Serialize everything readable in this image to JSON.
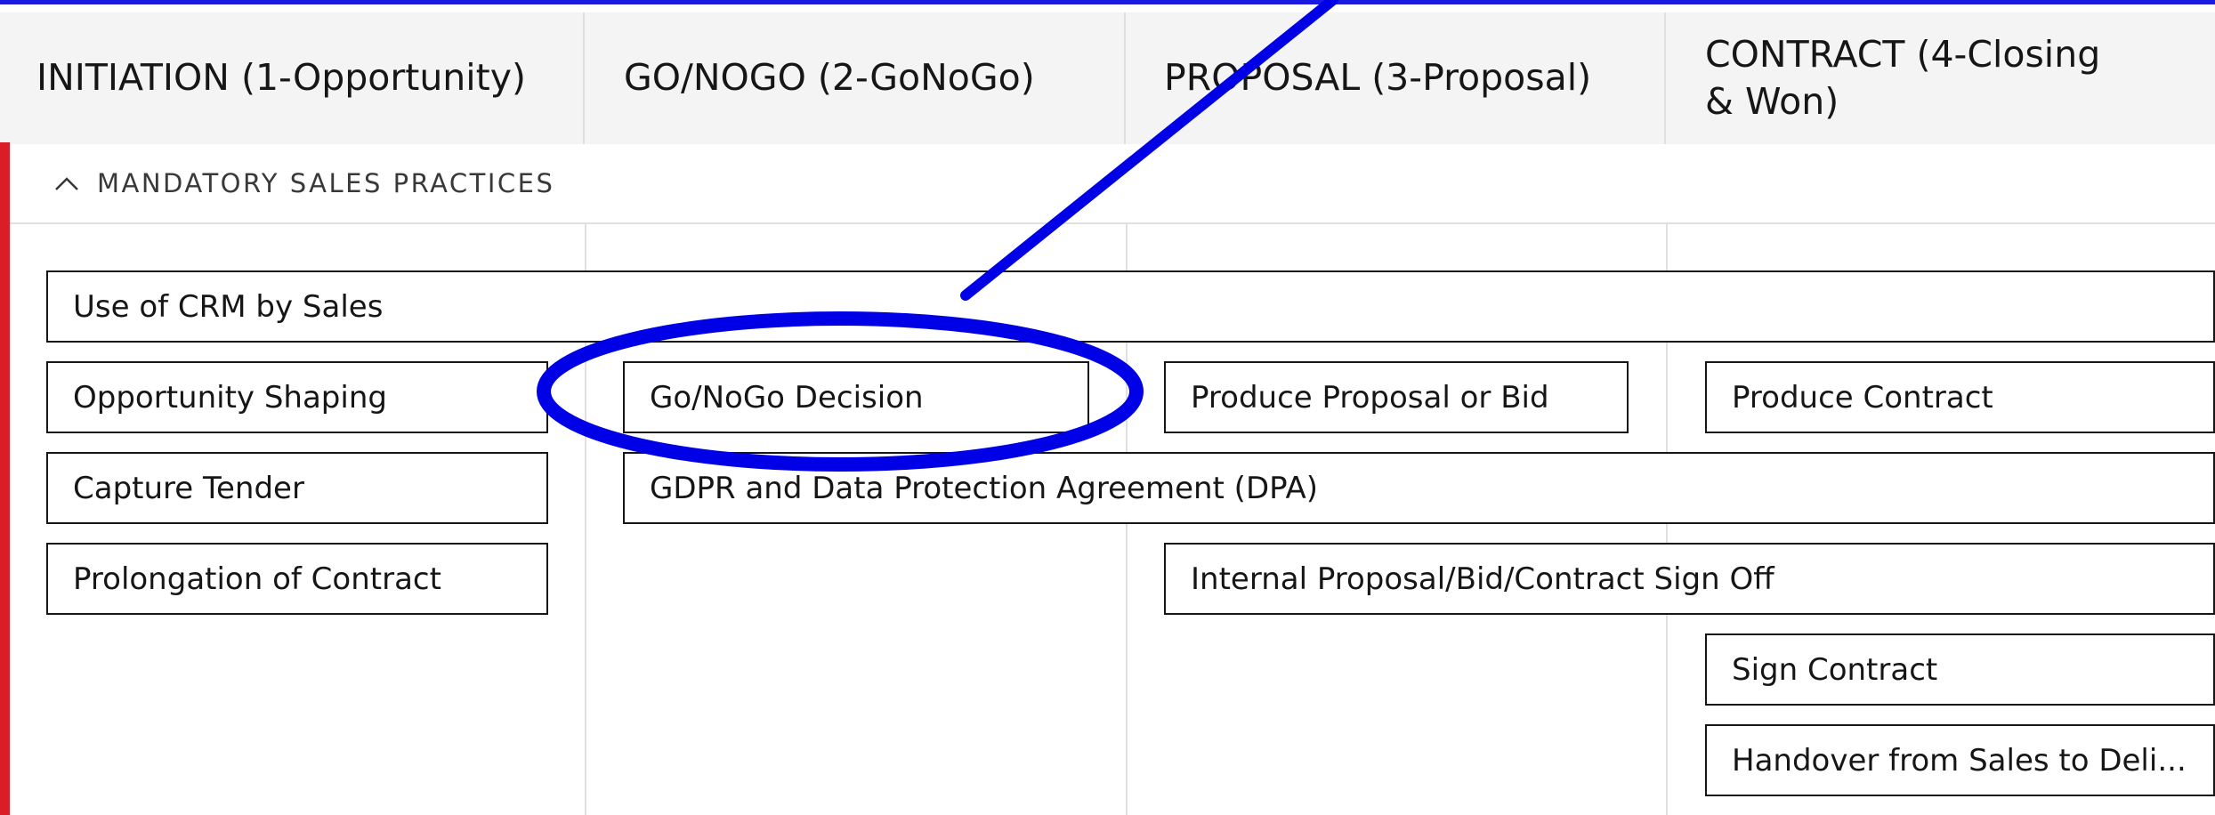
{
  "stages": [
    {
      "label": "INITIATION (1-Opportunity)"
    },
    {
      "label": "GO/NOGO (2-GoNoGo)"
    },
    {
      "label": "PROPOSAL (3-Proposal)"
    },
    {
      "label": "CONTRACT (4-Closing & Won)"
    }
  ],
  "section": {
    "title": "MANDATORY SALES PRACTICES",
    "expanded": true,
    "icon": "chevron-up-icon"
  },
  "practices": {
    "crm": "Use of CRM by Sales",
    "opportunity_shaping": "Opportunity Shaping",
    "capture_tender": "Capture Tender",
    "prolongation": "Prolongation of Contract",
    "gonogo_decision": "Go/NoGo Decision",
    "gdpr": "GDPR and Data Protection Agreement (DPA)",
    "produce_proposal": "Produce Proposal or Bid",
    "internal_signoff": "Internal Proposal/Bid/Contract Sign Off",
    "produce_contract": "Produce Contract",
    "sign_contract": "Sign Contract",
    "handover": "Handover from Sales to Deli..."
  },
  "annotation": {
    "color": "#0000e6",
    "highlighted_item": "Go/NoGo Decision"
  },
  "colors": {
    "accent_left": "#da1e28",
    "header_bg": "#f4f4f4",
    "box_border": "#161616"
  }
}
